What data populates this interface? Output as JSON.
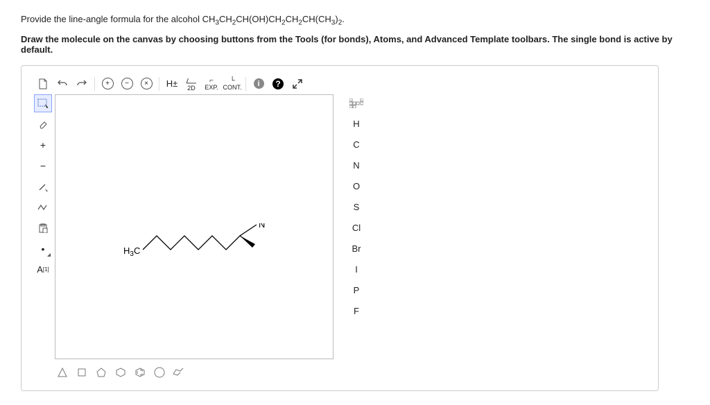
{
  "question": {
    "prompt_prefix": "Provide the line-angle formula for the alcohol CH",
    "prompt_suffix": ".",
    "formula_parts": {
      "p1": "3",
      "p2": "CH",
      "p3": "2",
      "p4": "CH(OH)CH",
      "p5": "2",
      "p6": "CH",
      "p7": "2",
      "p8": "CH(CH",
      "p9": "3",
      "p10": ")",
      "p11": "2"
    },
    "instruction": "Draw the molecule on the canvas by choosing buttons from the Tools (for bonds), Atoms, and Advanced Template toolbars. The single bond is active by default."
  },
  "toolbar": {
    "top": {
      "new": "",
      "undo": "",
      "redo": "",
      "zoom_in": "+",
      "zoom_out": "−",
      "zoom_fit": "×",
      "h_toggle": "H±",
      "view2d": "2D",
      "exp": "EXP.",
      "cont": "CONT.",
      "info": "i",
      "help": "?",
      "expand": ""
    },
    "left": {
      "marquee": "",
      "eraser": "",
      "plus": "+",
      "minus": "−",
      "single": "",
      "chain": "",
      "paste": "",
      "dot": "•",
      "label": "A"
    },
    "atoms": [
      "H",
      "C",
      "N",
      "O",
      "S",
      "Cl",
      "Br",
      "I",
      "P",
      "F"
    ],
    "templates": [
      "triangle",
      "square",
      "pentagon",
      "hexagon",
      "benzene",
      "cycloheptane",
      "chair"
    ]
  },
  "molecule": {
    "left_label": "H₃C",
    "right_label": "N"
  }
}
